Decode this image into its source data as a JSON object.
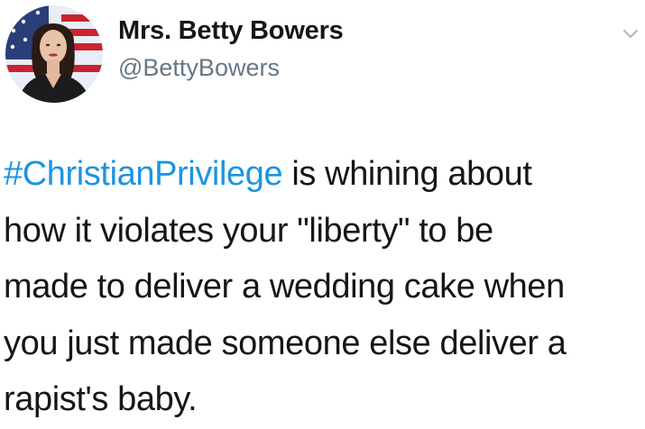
{
  "tweet": {
    "author": {
      "display_name": "Mrs. Betty Bowers",
      "handle": "@BettyBowers",
      "avatar_icon": "profile-photo-woman-flag-background"
    },
    "menu_icon": "chevron-down-icon",
    "text": {
      "hashtag": "#ChristianPrivilege",
      "line1_rest": " is whining about",
      "line2": "how it violates your \"liberty\" to be",
      "line3": "made to deliver a wedding cake when",
      "line4": "you just made someone else deliver a",
      "line5": "rapist's baby."
    }
  },
  "colors": {
    "text": "#14171a",
    "secondary_text": "#657786",
    "link": "#1b95e0",
    "background": "#ffffff"
  }
}
